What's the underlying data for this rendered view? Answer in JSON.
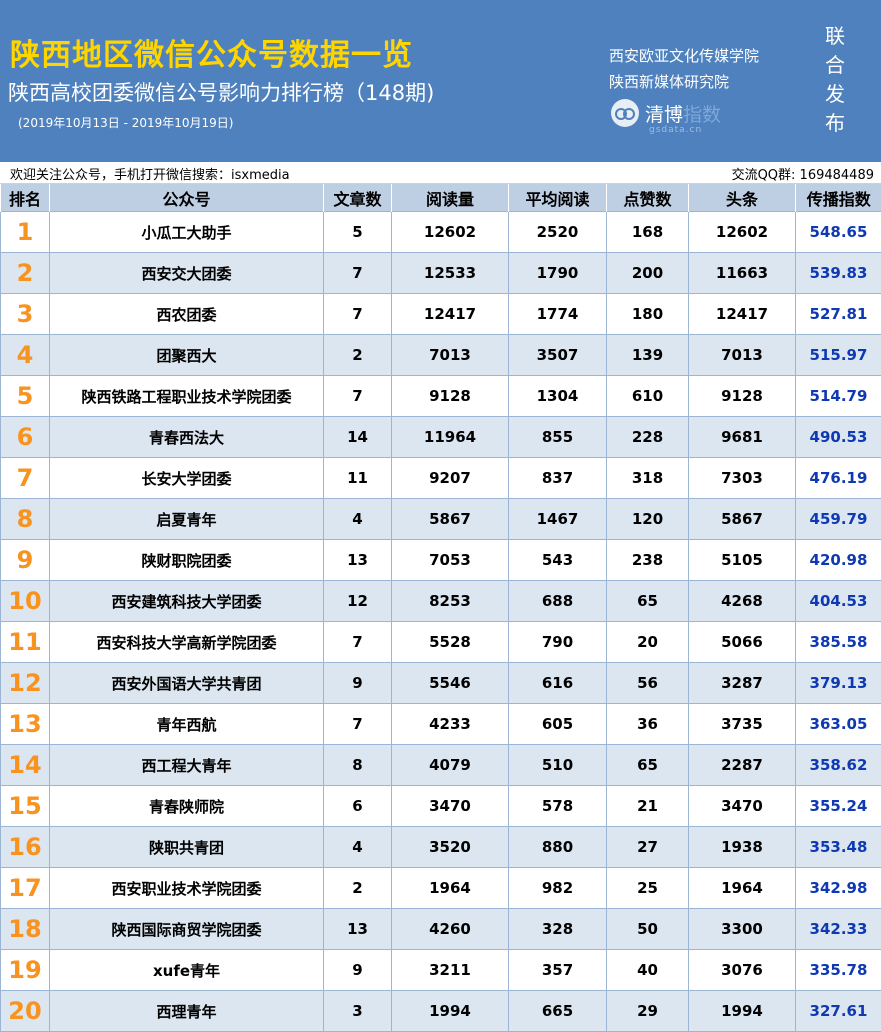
{
  "header": {
    "title": "陕西地区微信公众号数据一览",
    "subtitle": "陕西高校团委微信公号影响力排行榜（148期)",
    "period": "(2019年10月13日 - 2019年10月19日)",
    "institution_1": "西安欧亚文化传媒学院",
    "institution_2": "陕西新媒体研究院",
    "logo_name_1": "清博",
    "logo_name_2": "指数",
    "logo_sub": "gsdata.cn",
    "joint_chars": [
      "联",
      "合",
      "发",
      "布"
    ]
  },
  "info_bar": {
    "follow_text": "欢迎关注公众号，手机打开微信搜索：isxmedia",
    "qq_text": "交流QQ群: 169484489"
  },
  "table": {
    "headers": [
      "排名",
      "公众号",
      "文章数",
      "阅读量",
      "平均阅读",
      "点赞数",
      "头条",
      "传播指数"
    ],
    "rows": [
      {
        "rank": "1",
        "name": "小瓜工大助手",
        "articles": "5",
        "reads": "12602",
        "avg_reads": "2520",
        "likes": "168",
        "headline": "12602",
        "index": "548.65"
      },
      {
        "rank": "2",
        "name": "西安交大团委",
        "articles": "7",
        "reads": "12533",
        "avg_reads": "1790",
        "likes": "200",
        "headline": "11663",
        "index": "539.83"
      },
      {
        "rank": "3",
        "name": "西农团委",
        "articles": "7",
        "reads": "12417",
        "avg_reads": "1774",
        "likes": "180",
        "headline": "12417",
        "index": "527.81"
      },
      {
        "rank": "4",
        "name": "团聚西大",
        "articles": "2",
        "reads": "7013",
        "avg_reads": "3507",
        "likes": "139",
        "headline": "7013",
        "index": "515.97"
      },
      {
        "rank": "5",
        "name": "陕西铁路工程职业技术学院团委",
        "articles": "7",
        "reads": "9128",
        "avg_reads": "1304",
        "likes": "610",
        "headline": "9128",
        "index": "514.79"
      },
      {
        "rank": "6",
        "name": "青春西法大",
        "articles": "14",
        "reads": "11964",
        "avg_reads": "855",
        "likes": "228",
        "headline": "9681",
        "index": "490.53"
      },
      {
        "rank": "7",
        "name": "长安大学团委",
        "articles": "11",
        "reads": "9207",
        "avg_reads": "837",
        "likes": "318",
        "headline": "7303",
        "index": "476.19"
      },
      {
        "rank": "8",
        "name": "启夏青年",
        "articles": "4",
        "reads": "5867",
        "avg_reads": "1467",
        "likes": "120",
        "headline": "5867",
        "index": "459.79"
      },
      {
        "rank": "9",
        "name": "陕财职院团委",
        "articles": "13",
        "reads": "7053",
        "avg_reads": "543",
        "likes": "238",
        "headline": "5105",
        "index": "420.98"
      },
      {
        "rank": "10",
        "name": "西安建筑科技大学团委",
        "articles": "12",
        "reads": "8253",
        "avg_reads": "688",
        "likes": "65",
        "headline": "4268",
        "index": "404.53"
      },
      {
        "rank": "11",
        "name": "西安科技大学高新学院团委",
        "articles": "7",
        "reads": "5528",
        "avg_reads": "790",
        "likes": "20",
        "headline": "5066",
        "index": "385.58"
      },
      {
        "rank": "12",
        "name": "西安外国语大学共青团",
        "articles": "9",
        "reads": "5546",
        "avg_reads": "616",
        "likes": "56",
        "headline": "3287",
        "index": "379.13"
      },
      {
        "rank": "13",
        "name": "青年西航",
        "articles": "7",
        "reads": "4233",
        "avg_reads": "605",
        "likes": "36",
        "headline": "3735",
        "index": "363.05"
      },
      {
        "rank": "14",
        "name": "西工程大青年",
        "articles": "8",
        "reads": "4079",
        "avg_reads": "510",
        "likes": "65",
        "headline": "2287",
        "index": "358.62"
      },
      {
        "rank": "15",
        "name": "青春陕师院",
        "articles": "6",
        "reads": "3470",
        "avg_reads": "578",
        "likes": "21",
        "headline": "3470",
        "index": "355.24"
      },
      {
        "rank": "16",
        "name": "陕职共青团",
        "articles": "4",
        "reads": "3520",
        "avg_reads": "880",
        "likes": "27",
        "headline": "1938",
        "index": "353.48"
      },
      {
        "rank": "17",
        "name": "西安职业技术学院团委",
        "articles": "2",
        "reads": "1964",
        "avg_reads": "982",
        "likes": "25",
        "headline": "1964",
        "index": "342.98"
      },
      {
        "rank": "18",
        "name": "陕西国际商贸学院团委",
        "articles": "13",
        "reads": "4260",
        "avg_reads": "328",
        "likes": "50",
        "headline": "3300",
        "index": "342.33"
      },
      {
        "rank": "19",
        "name": "xufe青年",
        "articles": "9",
        "reads": "3211",
        "avg_reads": "357",
        "likes": "40",
        "headline": "3076",
        "index": "335.78"
      },
      {
        "rank": "20",
        "name": "西理青年",
        "articles": "3",
        "reads": "1994",
        "avg_reads": "665",
        "likes": "29",
        "headline": "1994",
        "index": "327.61"
      }
    ]
  },
  "colors": {
    "banner": "#4e81bd",
    "title": "#ffd500",
    "rank_number": "#f7931e",
    "index_value": "#0e39b2",
    "header_row": "#bfcfe3",
    "alt_row": "#dce6f1"
  }
}
